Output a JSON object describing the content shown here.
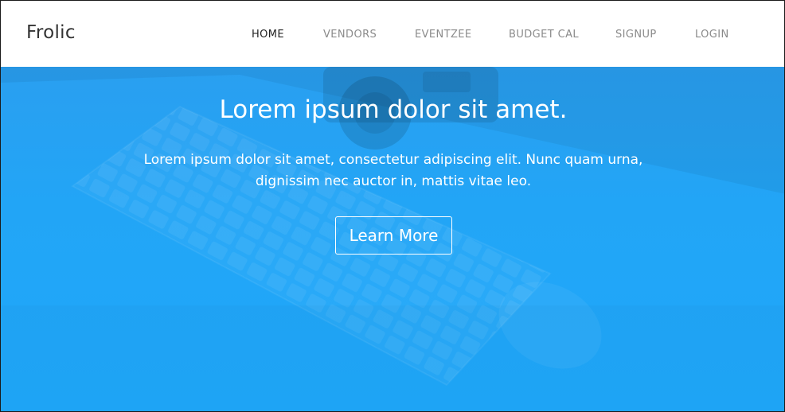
{
  "navbar": {
    "brand": "Frolic",
    "items": [
      {
        "label": "HOME",
        "active": true
      },
      {
        "label": "VENDORS",
        "active": false
      },
      {
        "label": "EVENTZEE",
        "active": false
      },
      {
        "label": "BUDGET CAL",
        "active": false
      },
      {
        "label": "SIGNUP",
        "active": false
      },
      {
        "label": "LOGIN",
        "active": false
      }
    ]
  },
  "hero": {
    "title": "Lorem ipsum dolor sit amet.",
    "text": "Lorem ipsum dolor sit amet, consectetur adipiscing elit. Nunc quam urna, dignissim nec auctor in, mattis vitae leo.",
    "button_label": "Learn More",
    "background_image": "desk-keyboard-camera-mouse-photo",
    "overlay_color": "#1fa8fa"
  }
}
